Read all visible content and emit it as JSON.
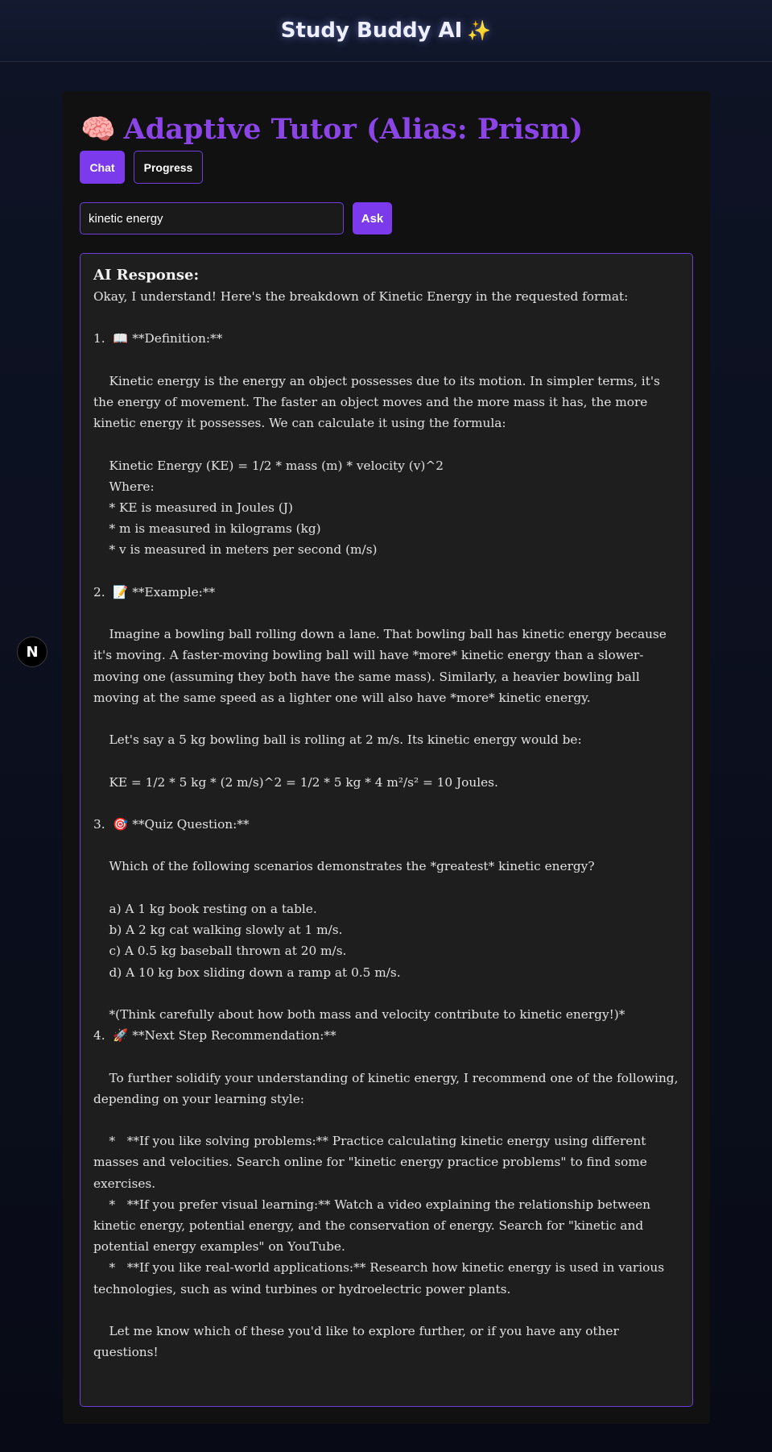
{
  "header": {
    "title": "Study Buddy AI",
    "sparkle": "✨"
  },
  "floating_badge": {
    "label": "N"
  },
  "tutor": {
    "emoji": "🧠",
    "title": "Adaptive Tutor (Alias: Prism)",
    "tabs": [
      {
        "label": "Chat",
        "active": true
      },
      {
        "label": "Progress",
        "active": false
      }
    ]
  },
  "search": {
    "value": "kinetic energy",
    "button_label": "Ask"
  },
  "response": {
    "label": "AI Response:",
    "text": "Okay, I understand! Here's the breakdown of Kinetic Energy in the requested format:\n\n1.  📖 **Definition:**\n\n    Kinetic energy is the energy an object possesses due to its motion. In simpler terms, it's the energy of movement. The faster an object moves and the more mass it has, the more kinetic energy it possesses. We can calculate it using the formula:\n\n    Kinetic Energy (KE) = 1/2 * mass (m) * velocity (v)^2\n    Where:\n    * KE is measured in Joules (J)\n    * m is measured in kilograms (kg)\n    * v is measured in meters per second (m/s)\n\n2.  📝 **Example:**\n\n    Imagine a bowling ball rolling down a lane. That bowling ball has kinetic energy because it's moving. A faster-moving bowling ball will have *more* kinetic energy than a slower-moving one (assuming they both have the same mass). Similarly, a heavier bowling ball moving at the same speed as a lighter one will also have *more* kinetic energy.\n\n    Let's say a 5 kg bowling ball is rolling at 2 m/s. Its kinetic energy would be:\n\n    KE = 1/2 * 5 kg * (2 m/s)^2 = 1/2 * 5 kg * 4 m²/s² = 10 Joules.\n\n3.  🎯 **Quiz Question:**\n\n    Which of the following scenarios demonstrates the *greatest* kinetic energy?\n\n    a) A 1 kg book resting on a table.\n    b) A 2 kg cat walking slowly at 1 m/s.\n    c) A 0.5 kg baseball thrown at 20 m/s.\n    d) A 10 kg box sliding down a ramp at 0.5 m/s.\n\n    *(Think carefully about how both mass and velocity contribute to kinetic energy!)*\n4.  🚀 **Next Step Recommendation:**\n\n    To further solidify your understanding of kinetic energy, I recommend one of the following, depending on your learning style:\n\n    *   **If you like solving problems:** Practice calculating kinetic energy using different masses and velocities. Search online for \"kinetic energy practice problems\" to find some exercises.\n    *   **If you prefer visual learning:** Watch a video explaining the relationship between kinetic energy, potential energy, and the conservation of energy. Search for \"kinetic and potential energy examples\" on YouTube.\n    *   **If you like real-world applications:** Research how kinetic energy is used in various technologies, such as wind turbines or hydroelectric power plants.\n\n    Let me know which of these you'd like to explore further, or if you have any other questions!"
  },
  "colors": {
    "accent": "#7c3aed",
    "heading": "#8b45e6",
    "page_bg": "#0b0f1d",
    "panel_bg": "#111111",
    "response_bg": "#1e1e1e"
  }
}
